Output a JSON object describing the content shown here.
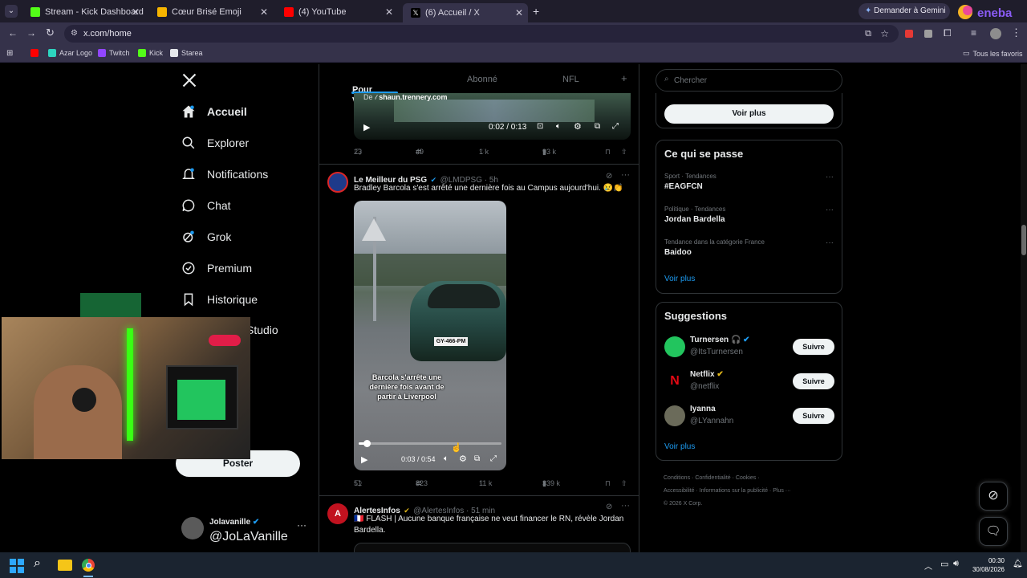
{
  "browser": {
    "tabs": [
      {
        "title": "Stream - Kick Dashboard",
        "color": "#53fc18"
      },
      {
        "title": "Cœur Brisé Emoji",
        "color": "#f7b500"
      },
      {
        "title": "(4) YouTube",
        "color": "#ff0000"
      },
      {
        "title": "(6) Accueil / X",
        "color": "#ffffff"
      }
    ],
    "gemini_label": "Demander à Gemini",
    "url": "x.com/home",
    "bookmarks": [
      "Azar Logo",
      "Twitch",
      "Kick",
      "Starea"
    ],
    "all_bookmarks": "Tous les favoris"
  },
  "nav": {
    "items": [
      "Accueil",
      "Explorer",
      "Notifications",
      "Chat",
      "Grok",
      "Premium",
      "Historique",
      "Studio"
    ],
    "post_button": "Poster",
    "user": {
      "name": "Jolavanille",
      "handle": "@JoLaVanille"
    }
  },
  "timeline": {
    "tabs": [
      "Pour vous",
      "Abonné",
      "NFL"
    ],
    "post1": {
      "source": "De",
      "source_domain": "shaun.trennery.com",
      "time": "0:02 / 0:13",
      "replies": "23",
      "reposts": "49",
      "likes": "1 k",
      "views": "93 k"
    },
    "post2": {
      "author": "Le Meilleur du PSG",
      "handle": "@LMDPSG · 5h",
      "text": "Bradley Barcola s'est arrêté une dernière fois au Campus aujourd'hui. 😢👏",
      "video_caption": "Barcola s'arrête une dernière fois avant de partir à Liverpool",
      "plate": "GY-466-PM",
      "time": "0:03 / 0:54",
      "progress": 0.055,
      "replies": "51",
      "reposts": "823",
      "likes": "11 k",
      "views": "339 k"
    },
    "post3": {
      "author": "AlertesInfos",
      "handle": "@AlertesInfos · 51 min",
      "text": "🇫🇷 FLASH | Aucune banque française ne veut financer le RN, révèle Jordan Bardella."
    }
  },
  "sidebar": {
    "search_placeholder": "Chercher",
    "voir_plus_button": "Voir plus",
    "trends_title": "Ce qui se passe",
    "trends": [
      {
        "category": "Sport · Tendances",
        "name": "#EAGFCN"
      },
      {
        "category": "Politique · Tendances",
        "name": "Jordan Bardella"
      },
      {
        "category": "Tendance dans la catégorie France",
        "name": "Baidoo"
      }
    ],
    "trends_more": "Voir plus",
    "suggestions_title": "Suggestions",
    "suggestions": [
      {
        "name": "Turnersen 🎧",
        "handle": "@ItsTurnersen",
        "button": "Suivre"
      },
      {
        "name": "Netflix",
        "handle": "@netflix",
        "button": "Suivre"
      },
      {
        "name": "Iyanna",
        "handle": "@LYannahn",
        "button": "Suivre"
      }
    ],
    "suggestions_more": "Voir plus",
    "footer": [
      "Conditions",
      "Confidentialité",
      "Cookies",
      "Accessibilité",
      "Informations sur la publicité",
      "Plus ···"
    ],
    "copyright": "© 2026 X Corp."
  },
  "taskbar": {
    "time": "00:30",
    "date": "30/08/2026"
  }
}
